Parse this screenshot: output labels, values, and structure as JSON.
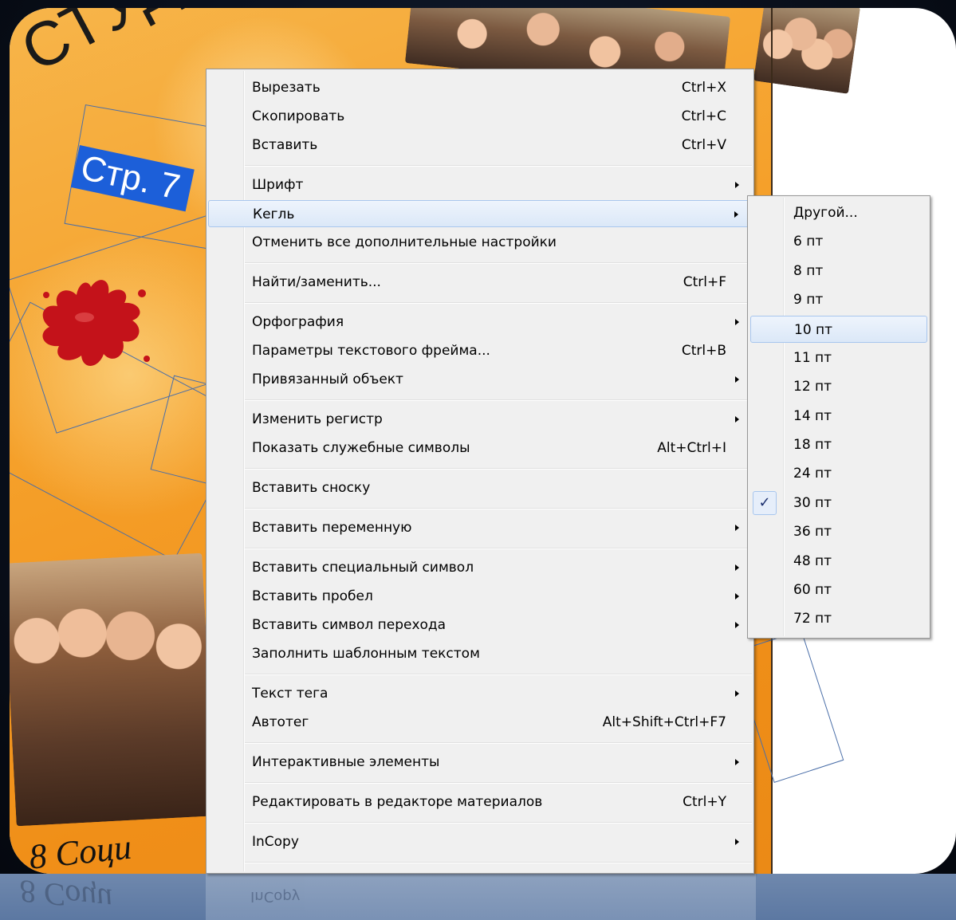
{
  "background_doc": {
    "title_fragment": "СТУД",
    "page_label": "Стр. 7",
    "bottom_fragment": "8 Соци"
  },
  "context_menu": {
    "items": [
      {
        "label": "Вырезать",
        "shortcut": "Ctrl+X",
        "submenu": false
      },
      {
        "label": "Скопировать",
        "shortcut": "Ctrl+C",
        "submenu": false
      },
      {
        "label": "Вставить",
        "shortcut": "Ctrl+V",
        "submenu": false
      },
      {
        "label": "Шрифт",
        "shortcut": "",
        "submenu": true
      },
      {
        "label": "Кегль",
        "shortcut": "",
        "submenu": true,
        "highlighted": true
      },
      {
        "label": "Отменить все дополнительные настройки",
        "shortcut": "",
        "submenu": false
      },
      {
        "label": "Найти/заменить...",
        "shortcut": "Ctrl+F",
        "submenu": false
      },
      {
        "label": "Орфография",
        "shortcut": "",
        "submenu": true
      },
      {
        "label": "Параметры текстового фрейма...",
        "shortcut": "Ctrl+B",
        "submenu": false
      },
      {
        "label": "Привязанный объект",
        "shortcut": "",
        "submenu": true
      },
      {
        "label": "Изменить регистр",
        "shortcut": "",
        "submenu": true
      },
      {
        "label": "Показать служебные символы",
        "shortcut": "Alt+Ctrl+I",
        "submenu": false
      },
      {
        "label": "Вставить сноску",
        "shortcut": "",
        "submenu": false
      },
      {
        "label": "Вставить переменную",
        "shortcut": "",
        "submenu": true
      },
      {
        "label": "Вставить специальный символ",
        "shortcut": "",
        "submenu": true
      },
      {
        "label": "Вставить пробел",
        "shortcut": "",
        "submenu": true
      },
      {
        "label": "Вставить символ перехода",
        "shortcut": "",
        "submenu": true
      },
      {
        "label": "Заполнить шаблонным текстом",
        "shortcut": "",
        "submenu": false
      },
      {
        "label": "Текст тега",
        "shortcut": "",
        "submenu": true
      },
      {
        "label": "Автотег",
        "shortcut": "Alt+Shift+Ctrl+F7",
        "submenu": false
      },
      {
        "label": "Интерактивные элементы",
        "shortcut": "",
        "submenu": true
      },
      {
        "label": "Редактировать в редакторе материалов",
        "shortcut": "Ctrl+Y",
        "submenu": false
      },
      {
        "label": "InCopy",
        "shortcut": "",
        "submenu": true
      }
    ]
  },
  "size_submenu": {
    "items": [
      {
        "label": "Другой..."
      },
      {
        "label": "6 пт"
      },
      {
        "label": "8 пт"
      },
      {
        "label": "9 пт"
      },
      {
        "label": "10 пт",
        "highlighted": true
      },
      {
        "label": "11 пт"
      },
      {
        "label": "12 пт"
      },
      {
        "label": "14 пт"
      },
      {
        "label": "18 пт"
      },
      {
        "label": "24 пт"
      },
      {
        "label": "30 пт",
        "checked": true
      },
      {
        "label": "36 пт"
      },
      {
        "label": "48 пт"
      },
      {
        "label": "60 пт"
      },
      {
        "label": "72 пт"
      }
    ],
    "check_glyph": "✓"
  },
  "reflection": {
    "menu_item": "InCopy"
  },
  "colors": {
    "menu_bg": "#f0f0f0",
    "highlight_border": "#a8c6ee",
    "page_label_bg": "#1c5fd9",
    "doc_orange": "#f5a02a"
  }
}
